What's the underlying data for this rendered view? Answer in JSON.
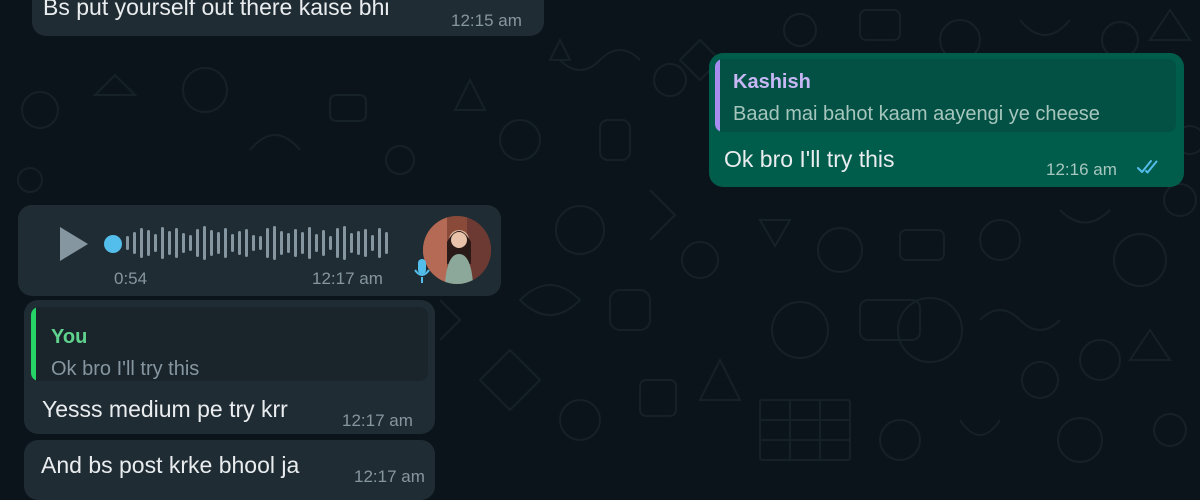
{
  "messages": [
    {
      "text": "Bs put yourself out there kaise bhi",
      "time": "12:15 am"
    },
    {
      "quote_author": "Kashish",
      "quote_text": "Baad mai bahot kaam aayengi ye cheese",
      "text": "Ok bro I'll try this",
      "time": "12:16 am",
      "status_icon": "double-check-read-icon"
    },
    {
      "duration": "0:54",
      "time": "12:17 am",
      "icons": [
        "play-icon",
        "microphone-icon"
      ],
      "avatar": "sender-avatar"
    },
    {
      "quote_author": "You",
      "quote_text": "Ok bro I'll try this",
      "text": "Yesss medium pe try krr",
      "time": "12:17 am"
    },
    {
      "text": "And bs post krke bhool ja",
      "time": "12:17 am"
    }
  ],
  "colors": {
    "background": "#0b141a",
    "incoming_bubble": "#202c33",
    "outgoing_bubble": "#005c4b",
    "read_ticks": "#53bdeb",
    "quote_bar_kashish": "#a88cf0",
    "quote_bar_you": "#25d366",
    "author_kashish": "#c7b7f5",
    "author_you": "#5fd38d"
  }
}
